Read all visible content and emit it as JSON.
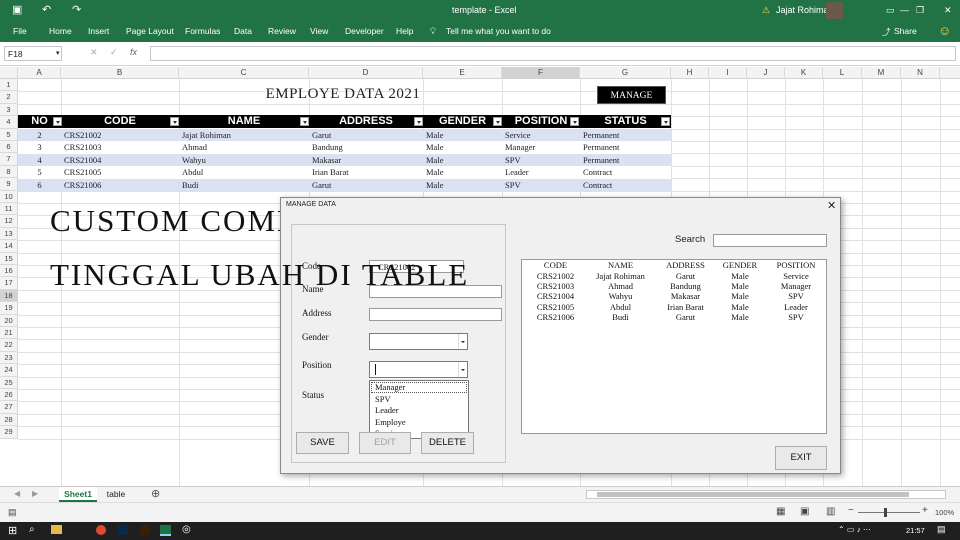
{
  "window": {
    "title": "template - Excel",
    "user": "Jajat Rohiman",
    "share": "Share"
  },
  "ribbon": {
    "tabs": [
      "File",
      "Home",
      "Insert",
      "Page Layout",
      "Formulas",
      "Data",
      "Review",
      "View",
      "Developer",
      "Help"
    ],
    "tell_me": "Tell me what you want to do"
  },
  "formula_bar": {
    "name_box": "F18",
    "value": ""
  },
  "columns": [
    "A",
    "B",
    "C",
    "D",
    "E",
    "F",
    "G",
    "H",
    "I",
    "J",
    "K",
    "L",
    "M",
    "N"
  ],
  "rows": [
    "1",
    "2",
    "3",
    "4",
    "5",
    "6",
    "7",
    "8",
    "9",
    "10",
    "11",
    "12",
    "13",
    "14",
    "15",
    "16",
    "17",
    "18",
    "19",
    "20",
    "21",
    "22",
    "23",
    "24",
    "25",
    "26",
    "27",
    "28",
    "29"
  ],
  "sheet": {
    "title": "EMPLOYE DATA 2021",
    "manage_button": "MANAGE",
    "headers": [
      "NO",
      "CODE",
      "NAME",
      "ADDRESS",
      "GENDER",
      "POSITION",
      "STATUS"
    ],
    "rows": [
      [
        "2",
        "CRS21002",
        "Jajat Rohiman",
        "Garut",
        "Male",
        "Service",
        "Permanent"
      ],
      [
        "3",
        "CRS21003",
        "Ahmad",
        "Bandung",
        "Male",
        "Manager",
        "Permanent"
      ],
      [
        "4",
        "CRS21004",
        "Wahyu",
        "Makasar",
        "Male",
        "SPV",
        "Permanent"
      ],
      [
        "5",
        "CRS21005",
        "Abdul",
        "Irian Barat",
        "Male",
        "Leader",
        "Contract"
      ],
      [
        "6",
        "CRS21006",
        "Budi",
        "Garut",
        "Male",
        "SPV",
        "Contract"
      ]
    ],
    "row_colors": [
      "#d9e1f2",
      "#ffffff"
    ]
  },
  "overlay": {
    "line1": "CUSTOM COMBOBOX",
    "line2": "TINGGAL UBAH DI TABLE"
  },
  "dialog": {
    "title": "MANAGE DATA",
    "labels": {
      "code": "Code",
      "name": "Name",
      "address": "Address",
      "gender": "Gender",
      "position": "Position",
      "status": "Status"
    },
    "code_value": "CRS21002",
    "position_options": [
      "Manager",
      "SPV",
      "Leader",
      "Employe",
      "Service"
    ],
    "buttons": {
      "save": "SAVE",
      "edit": "EDIT",
      "delete": "DELETE",
      "exit": "EXIT"
    },
    "search_label": "Search",
    "list_headers": [
      "CODE",
      "NAME",
      "ADDRESS",
      "GENDER",
      "POSITION"
    ],
    "list_rows": [
      [
        "CRS21002",
        "Jajat Rohiman",
        "Garut",
        "Male",
        "Service"
      ],
      [
        "CRS21003",
        "Ahmad",
        "Bandung",
        "Male",
        "Manager"
      ],
      [
        "CRS21004",
        "Wahyu",
        "Makasar",
        "Male",
        "SPV"
      ],
      [
        "CRS21005",
        "Abdul",
        "Irian Barat",
        "Male",
        "Leader"
      ],
      [
        "CRS21006",
        "Budi",
        "Garut",
        "Male",
        "SPV"
      ]
    ]
  },
  "sheet_tabs": [
    "Sheet1",
    "table"
  ],
  "status": {
    "zoom": "100%",
    "time": "21:57"
  },
  "colors": {
    "excel_green": "#217346",
    "header_black": "#000000",
    "band_blue": "#d9e1f2"
  }
}
